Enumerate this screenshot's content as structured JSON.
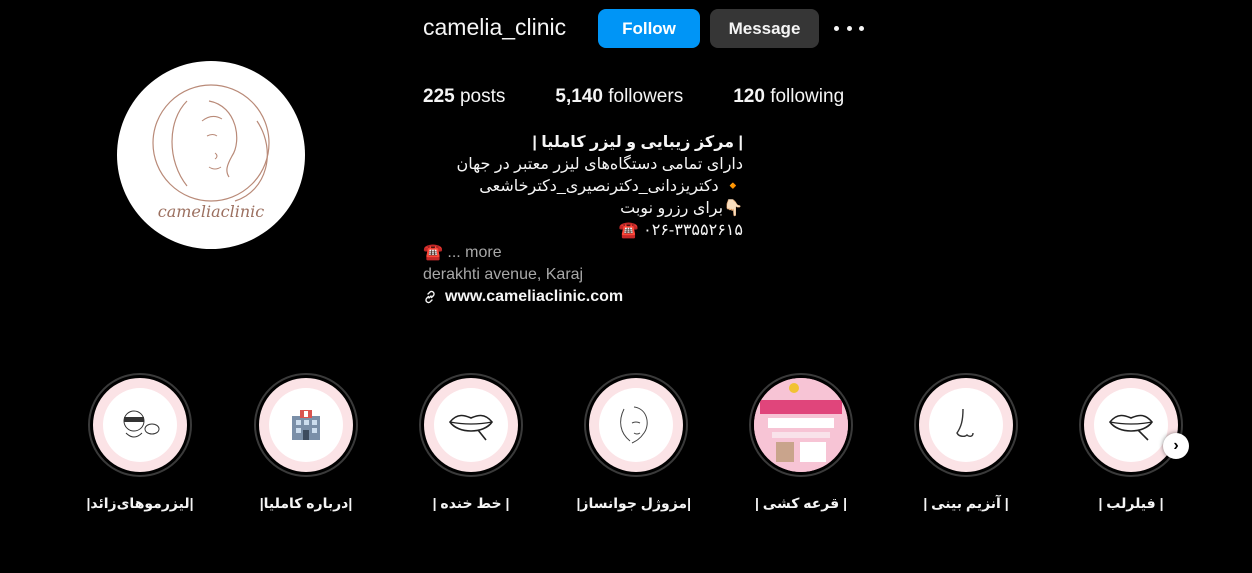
{
  "profile": {
    "username": "camelia_clinic",
    "follow_label": "Follow",
    "message_label": "Message",
    "more_icon": "more-horizontal-icon",
    "avatar_text": "cameliaclinic"
  },
  "stats": {
    "posts_count": "225",
    "posts_label": "posts",
    "followers_count": "5,140",
    "followers_label": "followers",
    "following_count": "120",
    "following_label": "following"
  },
  "bio": {
    "name": "| مرکز زیبایی و لیزر کاملیا |",
    "line1": "دارای تمامی دستگاه‌های لیزر معتبر در جهان",
    "line2": "🔸 دکتریزدانی_دکترنصیری_دکترخاشعی",
    "line3": "👇🏻برای رزرو نوبت",
    "line4": "☎️ ۰۲۶-۳۳۵۵۲۶۱۵",
    "line5_icon": "☎️",
    "more": "... more",
    "location": "derakhti avenue, Karaj",
    "link": "www.cameliaclinic.com"
  },
  "highlights": [
    {
      "label": "|لیزرموهای‌زائد|",
      "icon": "face-laser-icon"
    },
    {
      "label": "|درباره کاملیا|",
      "icon": "clinic-building-icon"
    },
    {
      "label": "| خط خنده |",
      "icon": "lips-icon"
    },
    {
      "label": "|مزوژل جوانساز|",
      "icon": "face-outline-icon"
    },
    {
      "label": "| قرعه کشی |",
      "icon": "lottery-poster-icon"
    },
    {
      "label": "| آنزیم بینی |",
      "icon": "nose-icon"
    },
    {
      "label": "| فیلرلب |",
      "icon": "lip-filler-icon"
    }
  ],
  "colors": {
    "follow_blue": "#0095f6",
    "message_gray": "#363636",
    "highlight_pink": "#fbe3e6",
    "background": "#000000"
  }
}
